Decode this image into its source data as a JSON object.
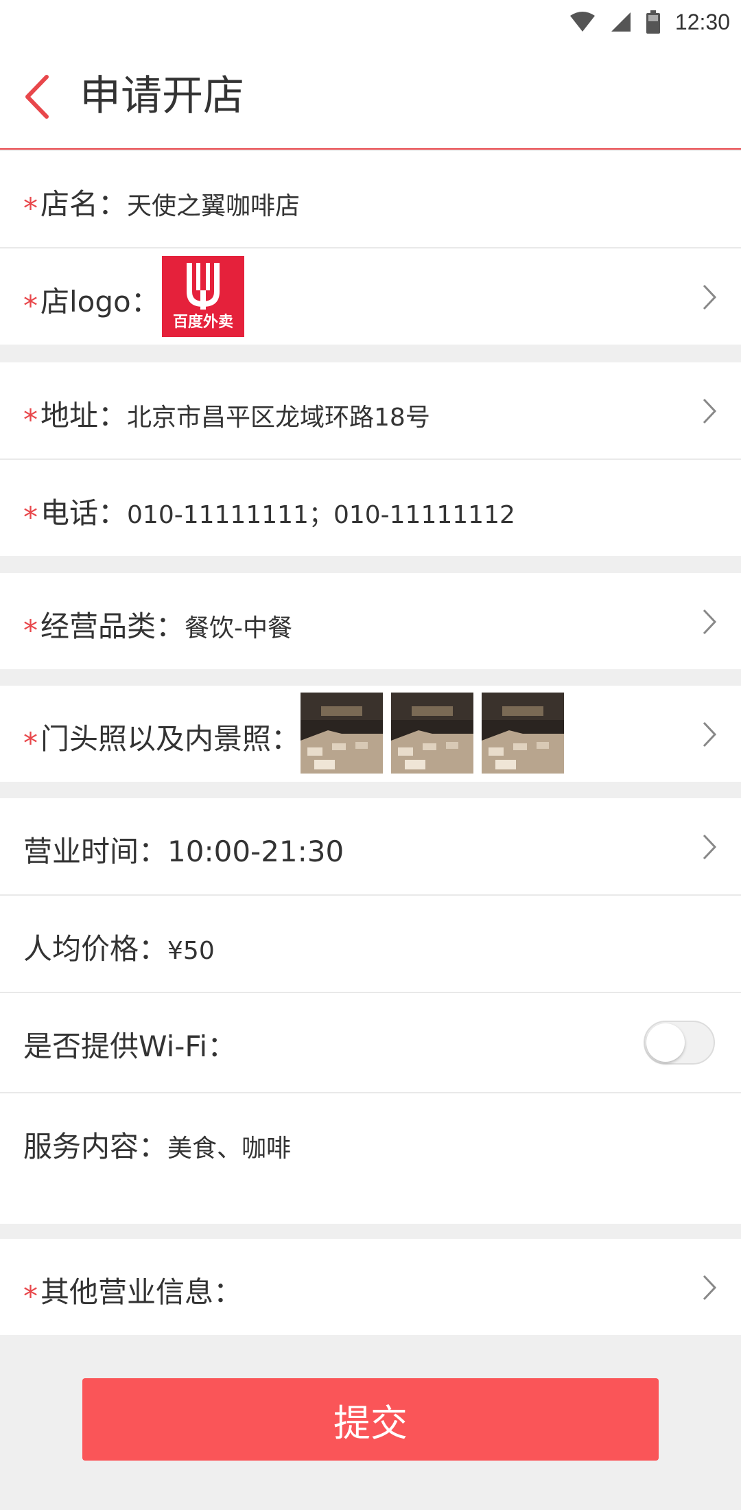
{
  "status_bar": {
    "time": "12:30"
  },
  "header": {
    "title": "申请开店"
  },
  "colors": {
    "accent": "#e8474b",
    "submit": "#fa5558"
  },
  "form": {
    "store_name": {
      "label": "店名：",
      "value": "天使之翼咖啡店",
      "required": true
    },
    "store_logo": {
      "label": "店logo：",
      "logo_text": "百度外卖",
      "required": true
    },
    "address": {
      "label": "地址：",
      "value": "北京市昌平区龙域环路18号",
      "required": true
    },
    "phone": {
      "label": "电话：",
      "value": "010-11111111；010-11111112",
      "required": true
    },
    "category": {
      "label": "经营品类：",
      "value": "餐饮-中餐",
      "required": true
    },
    "photos": {
      "label": "门头照以及内景照：",
      "count": 3,
      "required": true
    },
    "hours": {
      "label": "营业时间：",
      "value": "10:00-21:30"
    },
    "avg_price": {
      "label": "人均价格：",
      "value": "¥50"
    },
    "wifi": {
      "label": "是否提供Wi-Fi：",
      "enabled": false
    },
    "services": {
      "label": "服务内容：",
      "value": "美食、咖啡"
    },
    "other_info": {
      "label": "其他营业信息：",
      "required": true
    }
  },
  "submit": {
    "label": "提交"
  }
}
